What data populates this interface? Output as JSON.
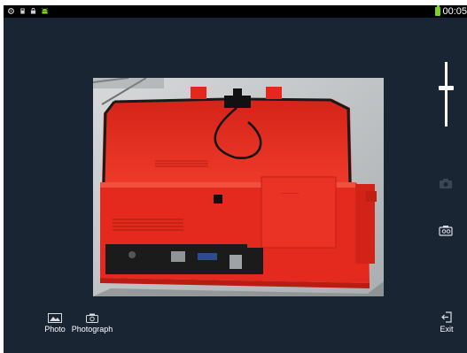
{
  "status_bar": {
    "time": "00:05",
    "icons": [
      "settings-icon",
      "sd-card-icon",
      "lock-icon",
      "android-icon",
      "battery-icon"
    ],
    "battery_color": "#7ed321"
  },
  "camera": {
    "zoom_level_fraction": 0.6
  },
  "bottom_bar": {
    "photo_label": "Photo",
    "photograph_label": "Photograph",
    "exit_label": "Exit"
  },
  "side_bar": {
    "icons": [
      "camera-switch-icon",
      "camera-mode-icon"
    ]
  },
  "colors": {
    "background": "#1a2534",
    "device_red": "#e42a1e",
    "text": "#ffffff"
  }
}
